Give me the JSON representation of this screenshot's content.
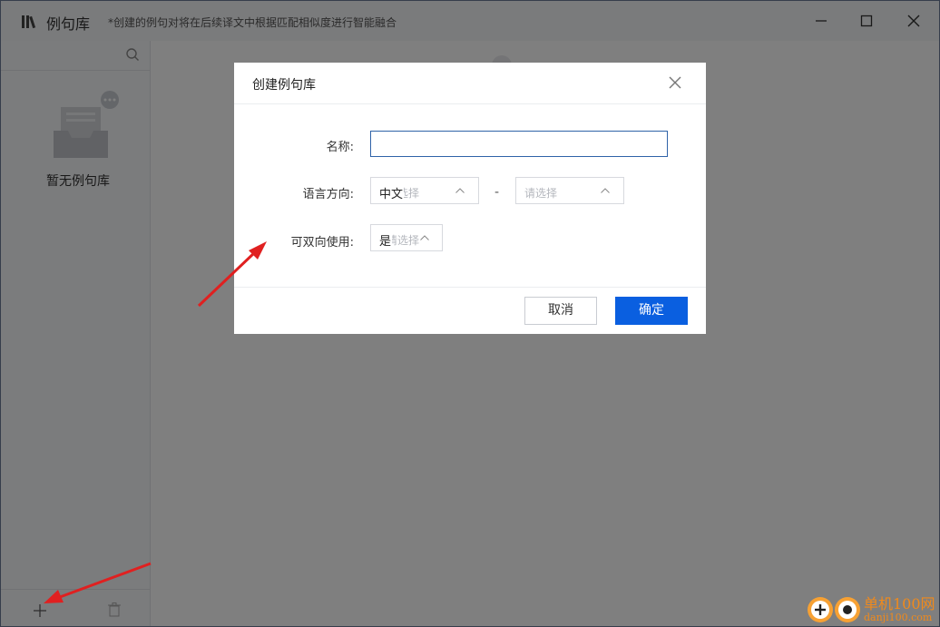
{
  "window": {
    "title": "例句库",
    "note": "*创建的例句对将在后续译文中根据匹配相似度进行智能融合"
  },
  "sidebar": {
    "empty_text": "暂无例句库"
  },
  "dialog": {
    "title": "创建例句库",
    "name_label": "名称:",
    "name_value": "",
    "language_label": "语言方向:",
    "source_language": "中文",
    "source_placeholder": "请选择",
    "target_placeholder": "请选择",
    "separator": "-",
    "bidirectional_label": "可双向使用:",
    "bidirectional_value": "是",
    "bidirectional_placeholder": "请选择",
    "cancel_label": "取消",
    "ok_label": "确定"
  },
  "watermark": {
    "line1": "单机100网",
    "line2": "danji100.com"
  },
  "colors": {
    "accent": "#0a5fe0",
    "annotation_arrow": "#e02020",
    "input_focus": "#2f63a8"
  }
}
